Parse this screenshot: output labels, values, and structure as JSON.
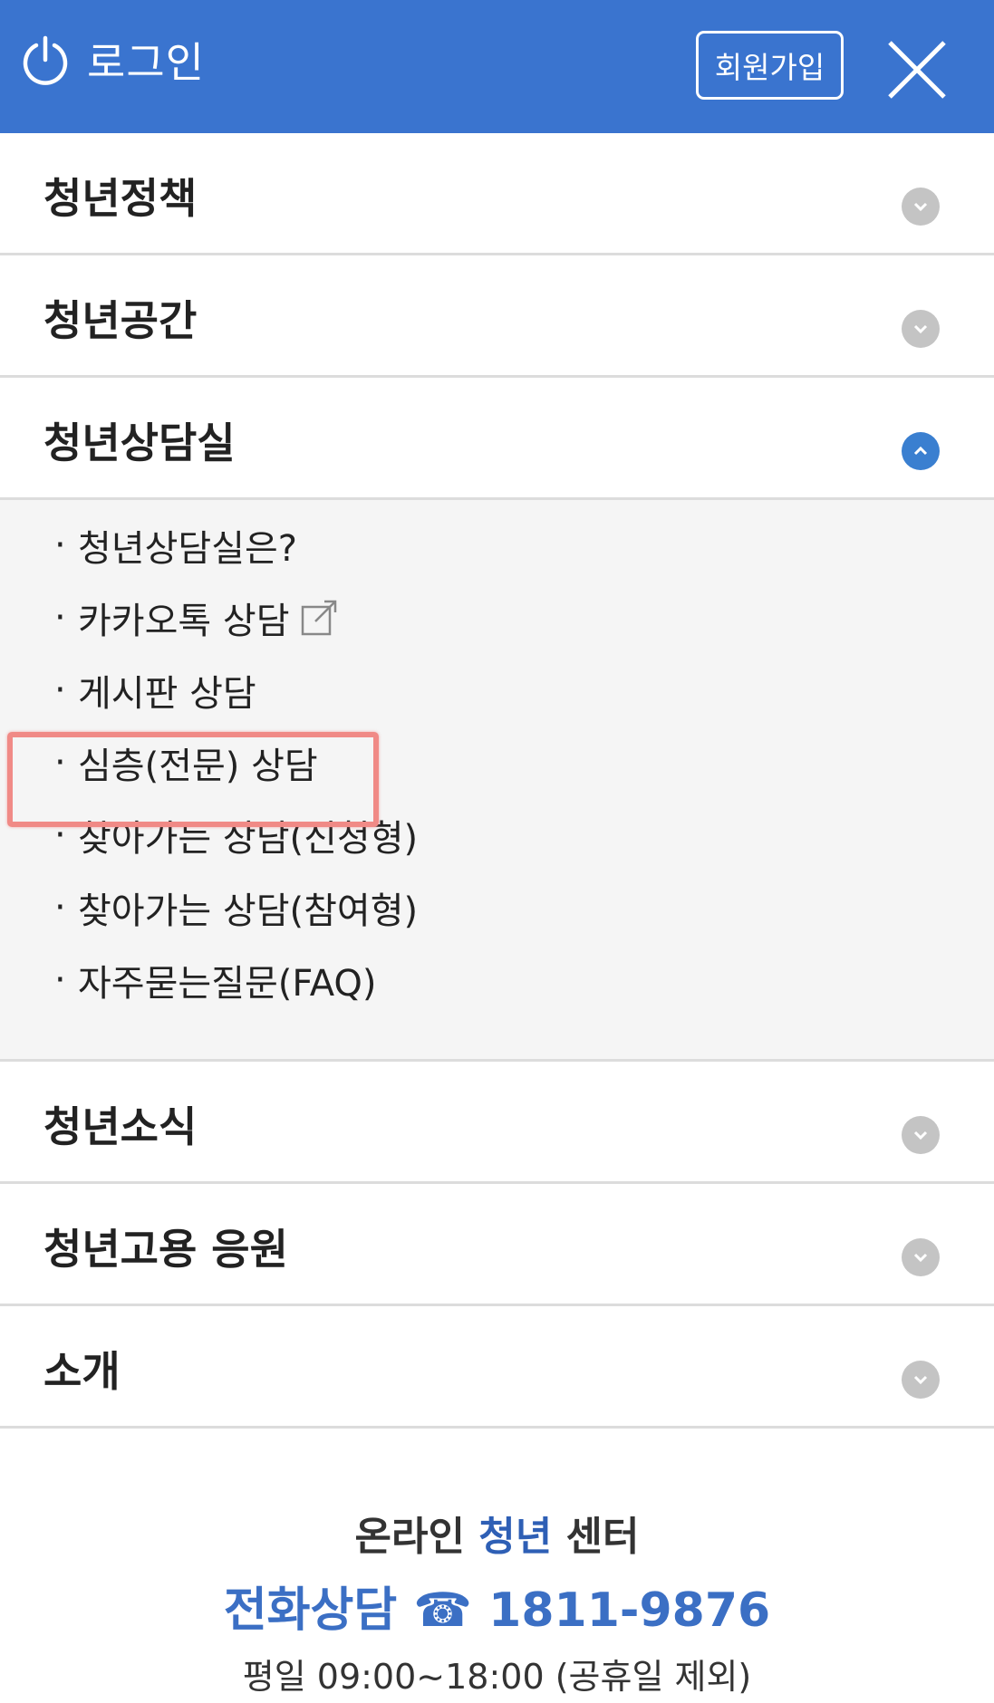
{
  "header": {
    "login_label": "로그인",
    "signup_label": "회원가입",
    "background_color": "#3a74cf"
  },
  "menu": [
    {
      "label": "청년정책",
      "expanded": false
    },
    {
      "label": "청년공간",
      "expanded": false
    },
    {
      "label": "청년상담실",
      "expanded": true
    },
    {
      "label": "청년소식",
      "expanded": false
    },
    {
      "label": "청년고용 응원",
      "expanded": false
    },
    {
      "label": "소개",
      "expanded": false
    }
  ],
  "submenu": {
    "bullet": "·",
    "items": [
      {
        "label": "청년상담실은?"
      },
      {
        "label": "카카오톡 상담",
        "icon": "external-link-icon"
      },
      {
        "label": "게시판 상담"
      },
      {
        "label": "심층(전문) 상담",
        "highlighted": true
      },
      {
        "label": "찾아가는 상담(신청형)"
      },
      {
        "label": "찾아가는 상담(참여형)"
      },
      {
        "label": "자주묻는질문(FAQ)"
      }
    ]
  },
  "footer": {
    "title_prefix": "온라인 ",
    "title_brand": "청년",
    "title_suffix": " 센터",
    "phone_label": "전화상담 ☎ 1811-9876",
    "hours": "평일 09:00~18:00 (공휴일 제외)"
  },
  "colors": {
    "accent": "#3a74cf",
    "highlight": "#f08a86",
    "expanded_chevron": "#3a7fd0",
    "collapsed_chevron": "#c4c4c4"
  }
}
